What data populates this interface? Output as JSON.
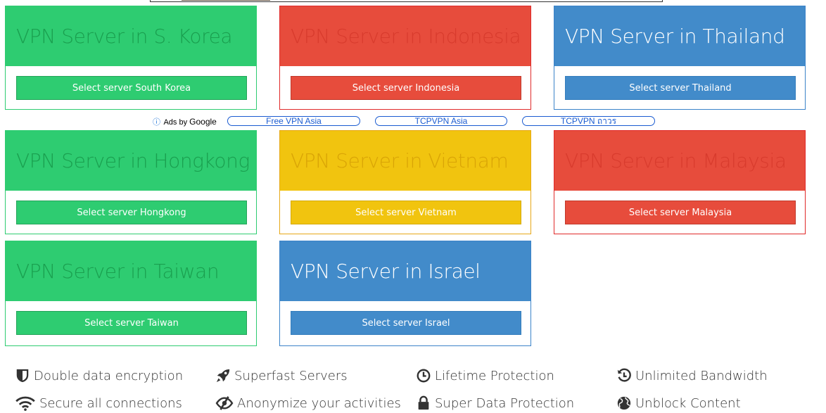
{
  "cards": [
    {
      "title": "VPN Server in S. Korea",
      "button": "Select server South Korea"
    },
    {
      "title": "VPN Server in Indonesia",
      "button": "Select server Indonesia"
    },
    {
      "title": "VPN Server in Thailand",
      "button": "Select server Thailand"
    },
    {
      "title": "VPN Server in Hongkong",
      "button": "Select server Hongkong"
    },
    {
      "title": "VPN Server in Vietnam",
      "button": "Select server Vietnam"
    },
    {
      "title": "VPN Server in Malaysia",
      "button": "Select server Malaysia"
    },
    {
      "title": "VPN Server in Taiwan",
      "button": "Select server Taiwan"
    },
    {
      "title": "VPN Server in Israel",
      "button": "Select server Israel"
    }
  ],
  "ads": {
    "info_icon": "ⓘ",
    "label_prefix": "Ads by",
    "label_google": "Google",
    "links": [
      "Free VPN Asia",
      "TCPVPN Asia",
      "TCPVPN ถาวร"
    ]
  },
  "features": [
    {
      "label": "Double data encryption",
      "icon": "shield-icon"
    },
    {
      "label": "Superfast Servers",
      "icon": "rocket-icon"
    },
    {
      "label": "Lifetime Protection",
      "icon": "clock-icon"
    },
    {
      "label": "Unlimited Bandwidth",
      "icon": "history-icon"
    },
    {
      "label": "Secure all connections",
      "icon": "wifi-icon"
    },
    {
      "label": "Anonymize your activities",
      "icon": "eye-slash-icon"
    },
    {
      "label": "Super Data Protection",
      "icon": "lock-icon"
    },
    {
      "label": "Unblock Content",
      "icon": "globe-icon"
    }
  ],
  "colors": {
    "green": "#2ecc71",
    "red": "#e74c3c",
    "blue": "#428bca",
    "yellow": "#f1c40f"
  }
}
